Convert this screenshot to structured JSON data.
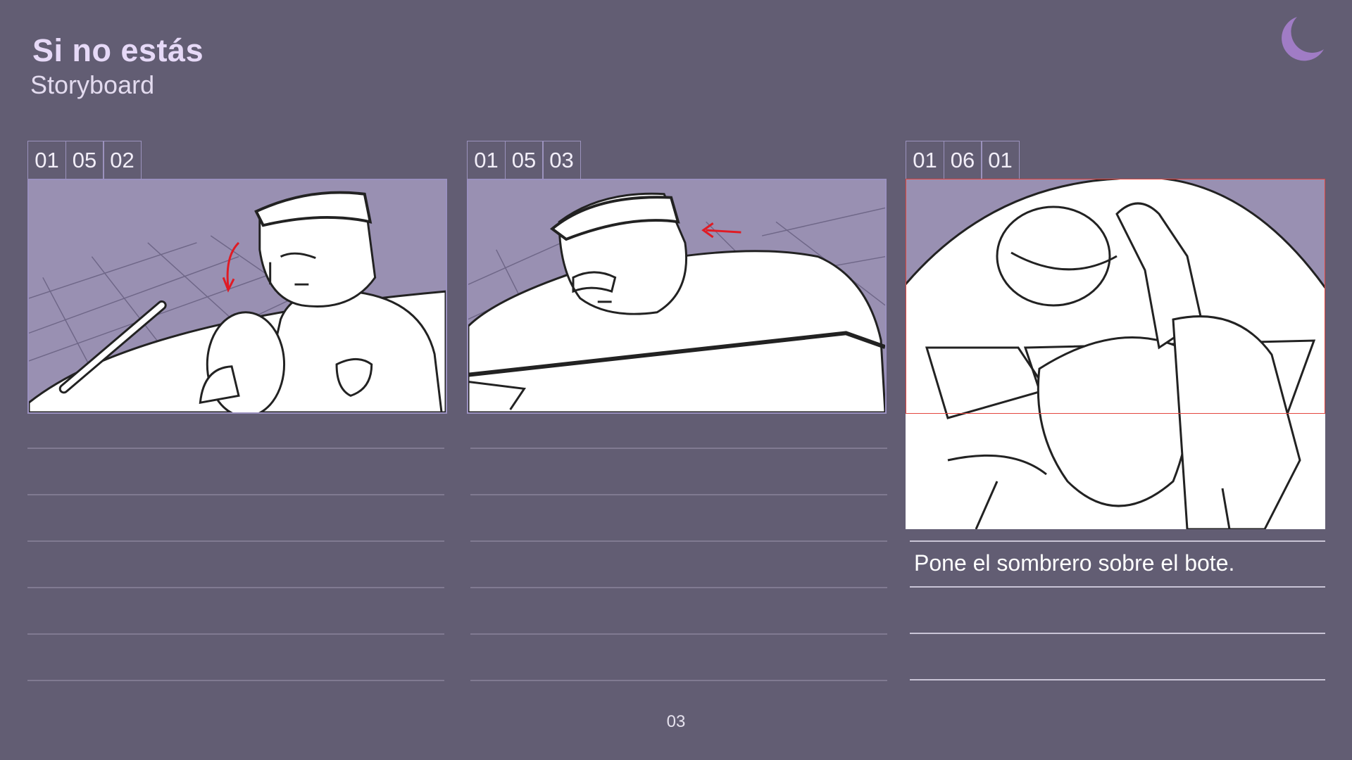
{
  "header": {
    "title": "Si no estás",
    "subtitle": "Storyboard"
  },
  "panels": [
    {
      "shot": [
        "01",
        "05",
        "02"
      ],
      "description": ""
    },
    {
      "shot": [
        "01",
        "05",
        "03"
      ],
      "description": ""
    },
    {
      "shot": [
        "01",
        "06",
        "01"
      ],
      "description": "Pone el sombrero sobre el bote."
    }
  ],
  "page_number": "03",
  "colors": {
    "background": "#625d73",
    "frame_border": "#9a90bf",
    "sketch_bg": "#9990b2",
    "arrow": "#e01b24",
    "moon": "#a07cc5"
  },
  "icons": {
    "logo": "moon-icon"
  }
}
